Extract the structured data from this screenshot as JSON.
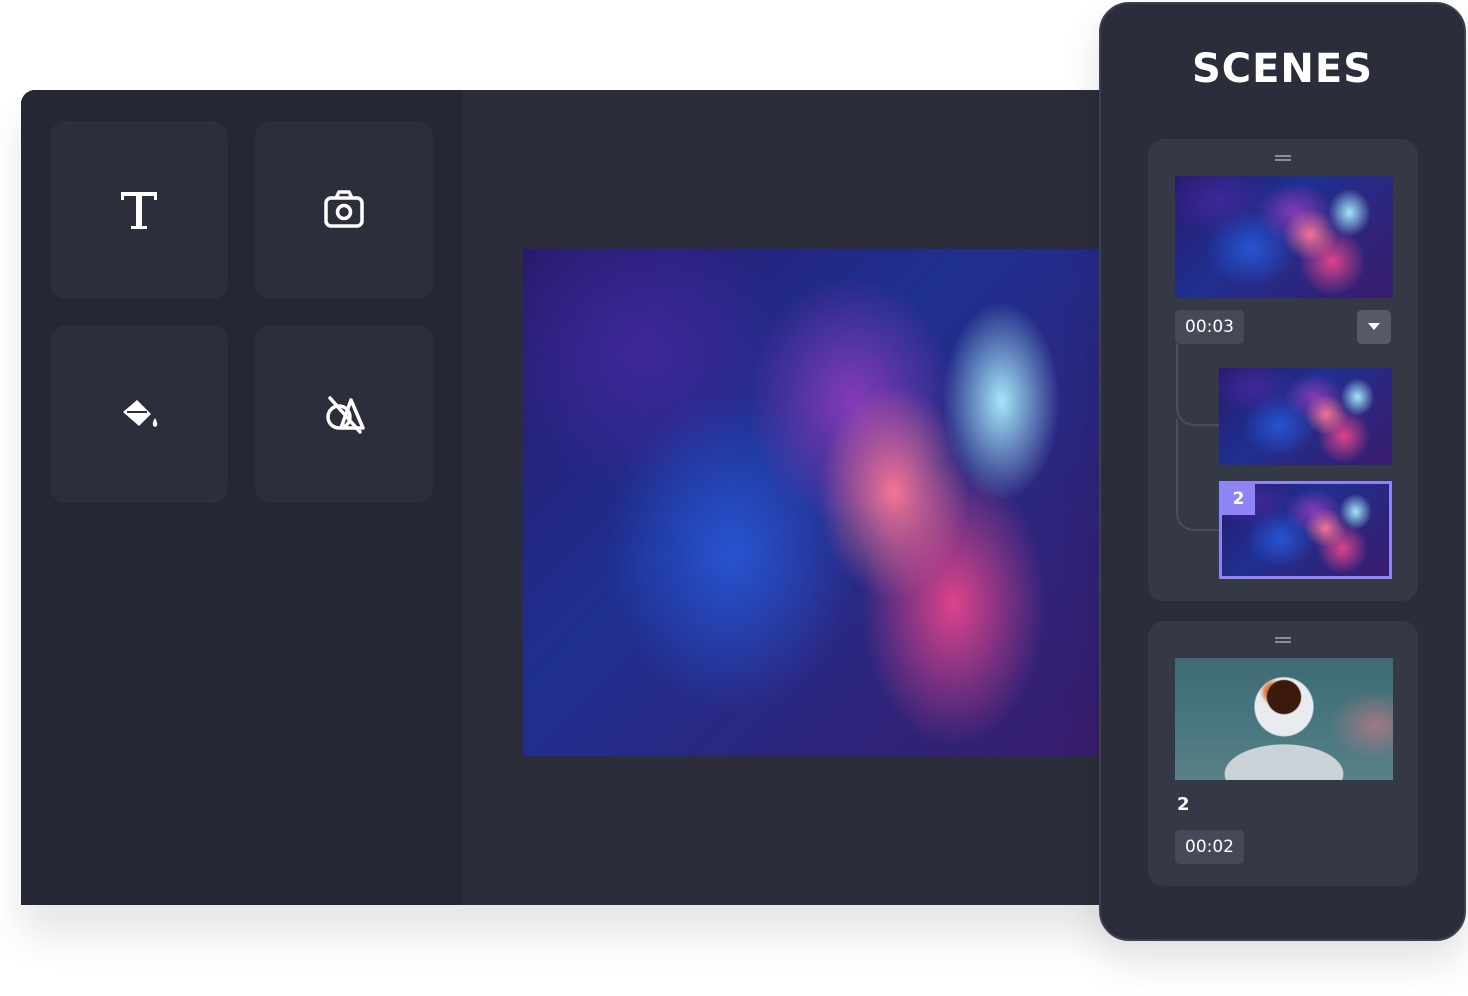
{
  "tools": [
    {
      "icon": "text-icon",
      "label": "T"
    },
    {
      "icon": "camera-icon"
    },
    {
      "icon": "paint-bucket-icon"
    },
    {
      "icon": "shapes-icon"
    }
  ],
  "scenes": {
    "title": "SCENES",
    "scene1": {
      "duration": "00:03",
      "sub_badge": "2"
    },
    "scene2": {
      "number": "2",
      "duration": "00:02"
    }
  },
  "colors": {
    "panel": "#2b2e3a",
    "tool_sidebar": "#252733",
    "tile": "#2c2f3b",
    "card": "#353845",
    "accent": "#8f84f5"
  }
}
